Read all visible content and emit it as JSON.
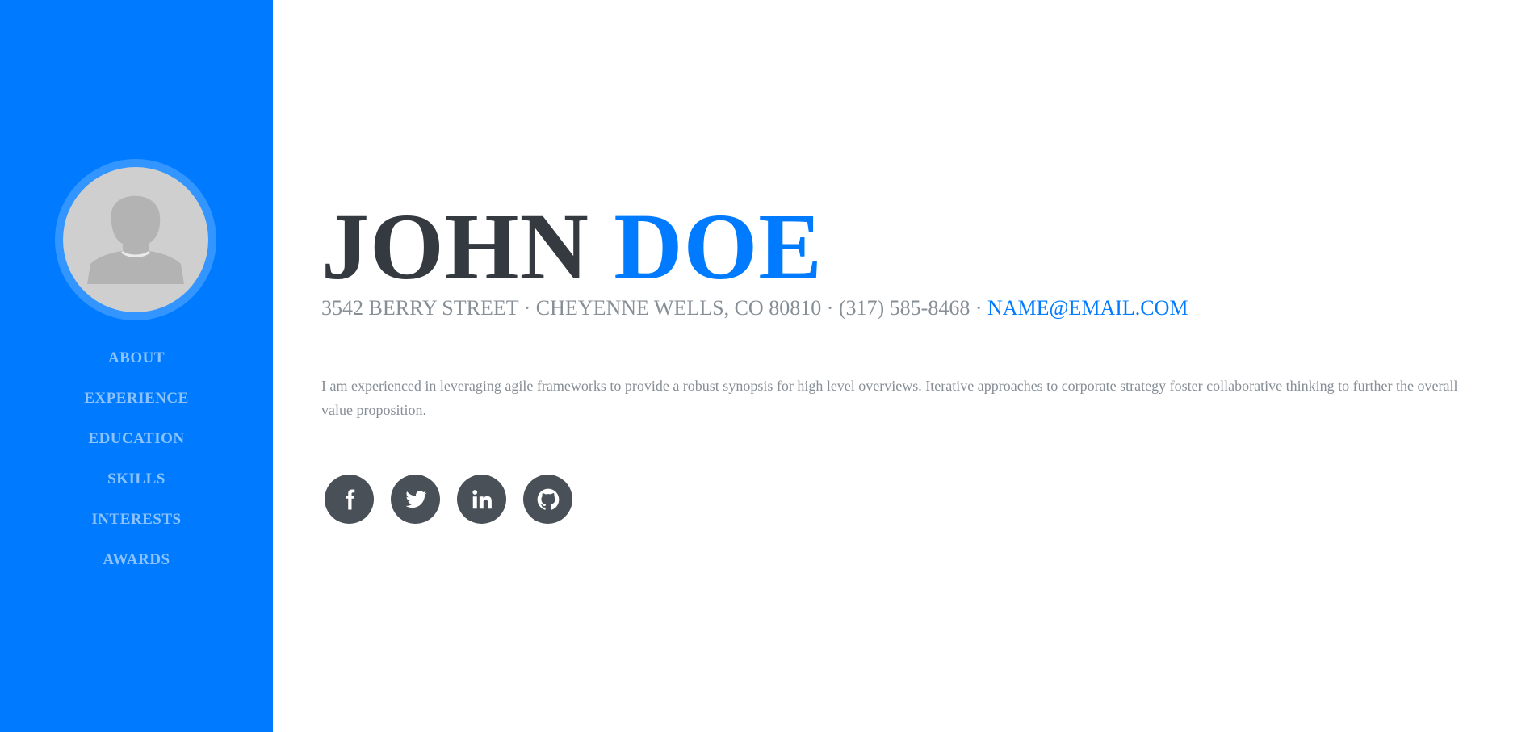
{
  "sidebar": {
    "nav_items": [
      {
        "label": "ABOUT"
      },
      {
        "label": "EXPERIENCE"
      },
      {
        "label": "EDUCATION"
      },
      {
        "label": "SKILLS"
      },
      {
        "label": "INTERESTS"
      },
      {
        "label": "AWARDS"
      }
    ],
    "avatar_icon": "person-silhouette-icon"
  },
  "header": {
    "first_name": "JOHN",
    "last_name": "DOE"
  },
  "contact": {
    "address": "3542 BERRY STREET · CHEYENNE WELLS, CO 80810 · (317) 585-8468 · ",
    "email": "NAME@EMAIL.COM"
  },
  "about": {
    "bio": "I am experienced in leveraging agile frameworks to provide a robust synopsis for high level overviews. Iterative approaches to corporate strategy foster collaborative thinking to further the overall value proposition."
  },
  "social": {
    "icons": [
      "facebook-icon",
      "twitter-icon",
      "linkedin-icon",
      "github-icon"
    ]
  },
  "colors": {
    "primary": "#007bff",
    "dark": "#343a40",
    "muted": "#868e96",
    "social_bg": "#495057"
  }
}
